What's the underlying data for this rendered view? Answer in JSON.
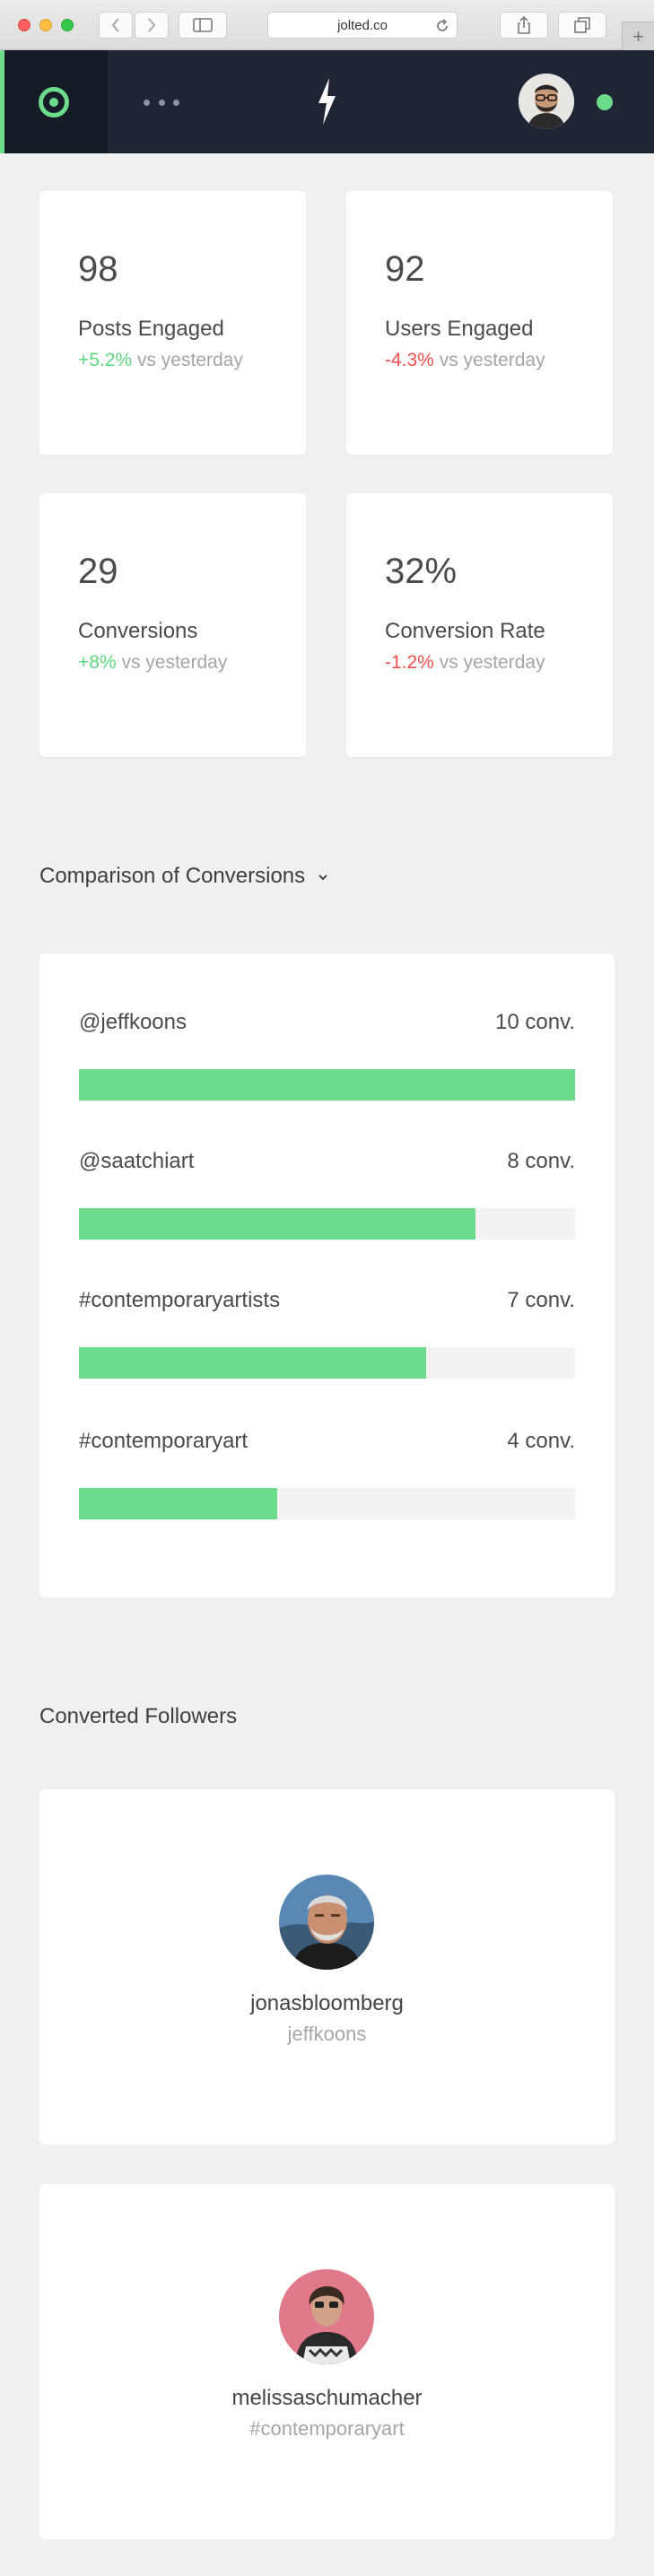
{
  "browser": {
    "url": "jolted.co"
  },
  "stats": [
    {
      "value": "98",
      "label": "Posts Engaged",
      "delta": "+5.2%",
      "delta_suffix": " vs yesterday",
      "trend": "up"
    },
    {
      "value": "92",
      "label": "Users Engaged",
      "delta": "-4.3%",
      "delta_suffix": " vs yesterday",
      "trend": "down"
    },
    {
      "value": "29",
      "label": "Conversions",
      "delta": "+8%",
      "delta_suffix": " vs yesterday",
      "trend": "up"
    },
    {
      "value": "32%",
      "label": "Conversion Rate",
      "delta": "-1.2%",
      "delta_suffix": " vs yesterday",
      "trend": "down"
    }
  ],
  "comparison": {
    "title": "Comparison of Conversions",
    "max": 10,
    "rows": [
      {
        "name": "@jeffkoons",
        "count_label": "10 conv.",
        "value": 10
      },
      {
        "name": "@saatchiart",
        "count_label": "8 conv.",
        "value": 8
      },
      {
        "name": "#contemporaryartists",
        "count_label": "7 conv.",
        "value": 7
      },
      {
        "name": "#contemporaryart",
        "count_label": "4 conv.",
        "value": 4
      }
    ]
  },
  "followers": {
    "title": "Converted Followers",
    "items": [
      {
        "name": "jonasbloomberg",
        "source": "jeffkoons"
      },
      {
        "name": "melissaschumacher",
        "source": "#contemporaryart"
      }
    ]
  },
  "colors": {
    "accent": "#6ddb8c",
    "negative": "#f0504c",
    "header_bg": "#1f2535"
  },
  "icons": {
    "home": "ring-icon",
    "more": "more-dots-icon",
    "logo": "lightning-bolt-icon"
  }
}
